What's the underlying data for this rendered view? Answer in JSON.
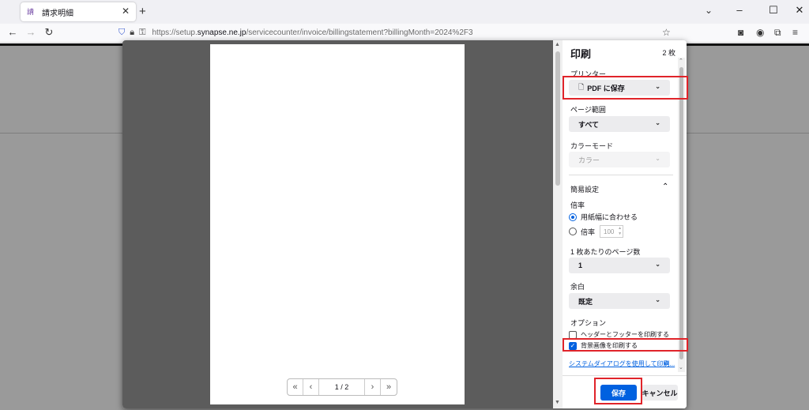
{
  "browser": {
    "tab_title": "請求明細",
    "tab_favicon": "請",
    "url_host_prefix": "https://setup.",
    "url_host": "synapse.ne.jp",
    "url_path": "/servicecounter/invoice/billingstatement?billingMonth=2024%2F3"
  },
  "preview": {
    "page_indicator": "1 / 2"
  },
  "print": {
    "title": "印刷",
    "sheet_count": "2 枚",
    "printer_label": "プリンター",
    "printer_value": "PDF に保存",
    "pages_label": "ページ範囲",
    "pages_value": "すべて",
    "color_label": "カラーモード",
    "color_value": "カラー",
    "more_settings": "簡易設定",
    "scale_label": "倍率",
    "scale_fit": "用紙幅に合わせる",
    "scale_custom": "倍率",
    "scale_value": "100",
    "pages_per_sheet_label": "1 枚あたりのページ数",
    "pages_per_sheet_value": "1",
    "margins_label": "余白",
    "margins_value": "既定",
    "options_label": "オプション",
    "opt_headers": "ヘッダーとフッターを印刷する",
    "opt_background": "背景画像を印刷する",
    "system_dialog_link": "システムダイアログを使用して印刷...",
    "save_button": "保存",
    "cancel_button": "キャンセル"
  },
  "colors": {
    "accent": "#0061e0",
    "highlight_red": "#e0242a"
  },
  "icons": [
    "document-icon",
    "shield-icon",
    "lock-icon",
    "key-icon",
    "star-icon",
    "pocket-icon",
    "account-icon",
    "extensions-icon",
    "menu-icon",
    "external-link-icon"
  ]
}
